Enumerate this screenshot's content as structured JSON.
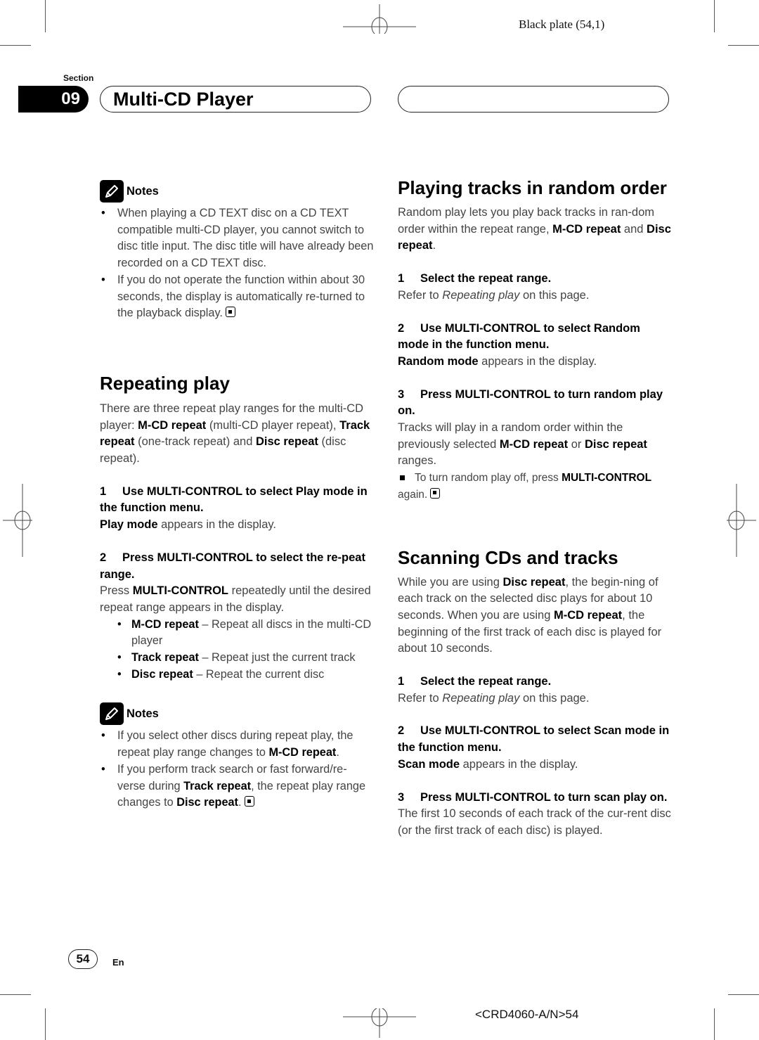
{
  "print": {
    "plate": "Black plate (54,1)",
    "code": "<CRD4060-A/N>54"
  },
  "header": {
    "section_label": "Section",
    "section_number": "09",
    "title": "Multi-CD Player"
  },
  "left": {
    "notes1": {
      "label": "Notes",
      "items": [
        "When playing a CD TEXT disc on a CD TEXT compatible multi-CD player, you cannot switch to disc title input. The disc title will have already been recorded on a CD TEXT disc.",
        "If you do not operate the function within about 30 seconds, the display is automatically re-turned to the playback display."
      ]
    },
    "repeating": {
      "heading": "Repeating play",
      "intro": {
        "a": "There are three repeat play ranges for the multi-CD player: ",
        "b1": "M-CD repeat",
        "c": " (multi-CD player repeat), ",
        "b2": "Track repeat",
        "d": " (one-track repeat) and ",
        "b3": "Disc repeat",
        "e": " (disc repeat)."
      },
      "step1": {
        "num": "1",
        "title": "Use MULTI-CONTROL to select Play mode in the function menu.",
        "body_bold": "Play mode",
        "body_rest": " appears in the display."
      },
      "step2": {
        "num": "2",
        "title": "Press MULTI-CONTROL to select the re-peat range.",
        "body_a": "Press ",
        "body_bold": "MULTI-CONTROL",
        "body_b": " repeatedly until the desired repeat range appears in the display.",
        "options": [
          {
            "name": "M-CD repeat",
            "desc": " – Repeat all discs in the multi-CD player"
          },
          {
            "name": "Track repeat",
            "desc": " – Repeat just the current track"
          },
          {
            "name": "Disc repeat",
            "desc": " – Repeat the current disc"
          }
        ]
      }
    },
    "notes2": {
      "label": "Notes",
      "item1_a": "If you select other discs during repeat play, the repeat play range changes to ",
      "item1_b": "M-CD repeat",
      "item1_c": ".",
      "item2_a": "If you perform track search or fast forward/re-verse during ",
      "item2_b": "Track repeat",
      "item2_c": ", the repeat play range changes to ",
      "item2_d": "Disc repeat",
      "item2_e": "."
    }
  },
  "right": {
    "random": {
      "heading": "Playing tracks in random order",
      "intro_a": "Random play lets you play back tracks in ran-dom order within the repeat range, ",
      "intro_b1": "M-CD repeat",
      "intro_c": " and ",
      "intro_b2": "Disc repeat",
      "intro_d": ".",
      "step1": {
        "num": "1",
        "title": "Select the repeat range.",
        "body_a": "Refer to ",
        "body_i": "Repeating play",
        "body_b": " on this page."
      },
      "step2": {
        "num": "2",
        "title": "Use MULTI-CONTROL to select Random mode in the function menu.",
        "body_bold": "Random mode",
        "body_rest": " appears in the display."
      },
      "step3": {
        "num": "3",
        "title": "Press MULTI-CONTROL to turn random play on.",
        "body_a": "Tracks will play in a random order within the previously selected ",
        "body_b1": "M-CD repeat",
        "body_c": " or ",
        "body_b2": "Disc repeat",
        "body_d": " ranges.",
        "tip_a": "To turn random play off, press ",
        "tip_b": "MULTI-CONTROL",
        "tip_c": " again."
      }
    },
    "scanning": {
      "heading": "Scanning CDs and tracks",
      "intro_a": "While you are using ",
      "intro_b1": "Disc repeat",
      "intro_c": ", the begin-ning of each track on the selected disc plays for about 10 seconds. When you are using ",
      "intro_b2": "M-CD repeat",
      "intro_d": ", the beginning of the first track of each disc is played for about 10 seconds.",
      "step1": {
        "num": "1",
        "title": "Select the repeat range.",
        "body_a": "Refer to ",
        "body_i": "Repeating play",
        "body_b": " on this page."
      },
      "step2": {
        "num": "2",
        "title": "Use MULTI-CONTROL to select Scan mode in the function menu.",
        "body_bold": "Scan mode",
        "body_rest": " appears in the display."
      },
      "step3": {
        "num": "3",
        "title": "Press MULTI-CONTROL to turn scan play on.",
        "body": "The first 10 seconds of each track of the cur-rent disc (or the first track of each disc) is played."
      }
    }
  },
  "footer": {
    "page_number": "54",
    "language": "En"
  }
}
